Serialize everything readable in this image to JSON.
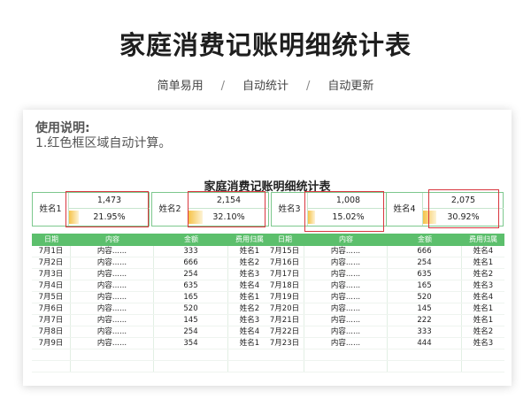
{
  "header": {
    "title": "家庭消费记账明细统计表",
    "features": [
      "简单易用",
      "自动统计",
      "自动更新"
    ],
    "separator": "/"
  },
  "notes": {
    "title": "使用说明:",
    "line1": "1.红色框区域自动计算。"
  },
  "sheet": {
    "title": "家庭消费记账明细统计表",
    "summaries": [
      {
        "name": "姓名1",
        "total": "1,473",
        "percent": "21.95%",
        "percent_value": 21.95
      },
      {
        "name": "姓名2",
        "total": "2,154",
        "percent": "32.10%",
        "percent_value": 32.1
      },
      {
        "name": "姓名3",
        "total": "1,008",
        "percent": "15.02%",
        "percent_value": 15.02
      },
      {
        "name": "姓名4",
        "total": "2,075",
        "percent": "30.92%",
        "percent_value": 30.92
      }
    ],
    "columns": [
      "日期",
      "内容",
      "金额",
      "费用归属"
    ],
    "left_rows": [
      {
        "date": "7月1日",
        "content": "内容......",
        "amount": "333",
        "who": "姓名1"
      },
      {
        "date": "7月2日",
        "content": "内容......",
        "amount": "666",
        "who": "姓名2"
      },
      {
        "date": "7月3日",
        "content": "内容......",
        "amount": "254",
        "who": "姓名3"
      },
      {
        "date": "7月4日",
        "content": "内容......",
        "amount": "635",
        "who": "姓名4"
      },
      {
        "date": "7月5日",
        "content": "内容......",
        "amount": "165",
        "who": "姓名1"
      },
      {
        "date": "7月6日",
        "content": "内容......",
        "amount": "520",
        "who": "姓名2"
      },
      {
        "date": "7月7日",
        "content": "内容......",
        "amount": "145",
        "who": "姓名3"
      },
      {
        "date": "7月8日",
        "content": "内容......",
        "amount": "254",
        "who": "姓名4"
      },
      {
        "date": "7月9日",
        "content": "内容......",
        "amount": "354",
        "who": "姓名1"
      }
    ],
    "right_rows": [
      {
        "date": "7月15日",
        "content": "内容......",
        "amount": "666",
        "who": "姓名4"
      },
      {
        "date": "7月16日",
        "content": "内容......",
        "amount": "254",
        "who": "姓名1"
      },
      {
        "date": "7月17日",
        "content": "内容......",
        "amount": "635",
        "who": "姓名2"
      },
      {
        "date": "7月18日",
        "content": "内容......",
        "amount": "165",
        "who": "姓名3"
      },
      {
        "date": "7月19日",
        "content": "内容......",
        "amount": "520",
        "who": "姓名4"
      },
      {
        "date": "7月20日",
        "content": "内容......",
        "amount": "145",
        "who": "姓名1"
      },
      {
        "date": "7月21日",
        "content": "内容......",
        "amount": "222",
        "who": "姓名1"
      },
      {
        "date": "7月22日",
        "content": "内容......",
        "amount": "333",
        "who": "姓名2"
      },
      {
        "date": "7月23日",
        "content": "内容......",
        "amount": "444",
        "who": "姓名3"
      }
    ]
  },
  "colors": {
    "header_green": "#5cbf6c",
    "highlight_red": "#d9363e",
    "bar_yellow": "#f6c34a"
  }
}
